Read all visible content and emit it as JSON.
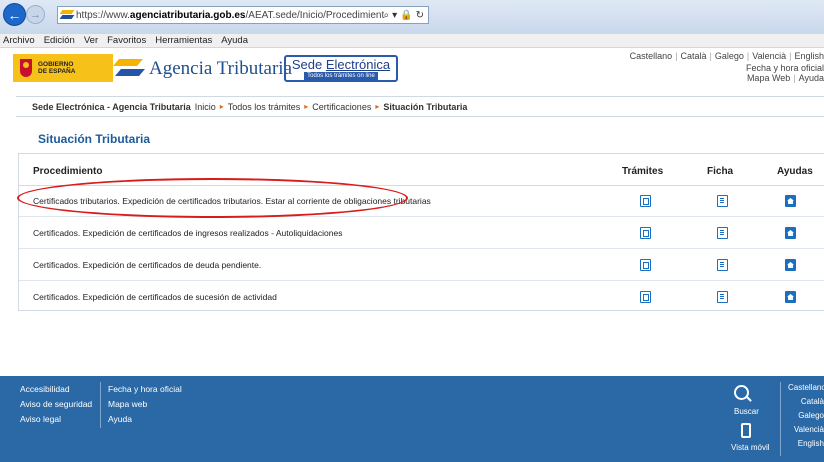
{
  "browser": {
    "url_prefix": "https://www.",
    "url_domain": "agenciatributaria.gob.es",
    "url_path": "/AEAT.sede/Inicio/Procedimientos_y_Servicios/Cert",
    "search_icon": "search-icon",
    "menu": [
      "Archivo",
      "Edición",
      "Ver",
      "Favoritos",
      "Herramientas",
      "Ayuda"
    ]
  },
  "header": {
    "gov_text": "GOBIERNO DE ESPAÑA",
    "agency_name": "Agencia Tributaria",
    "sede_title_plain": "Sede ",
    "sede_title_underlined": "Electrónica",
    "sede_sub": "Todos los trámites on line",
    "languages": [
      "Castellano",
      "Català",
      "Galego",
      "Valencià",
      "English"
    ],
    "util1": "Fecha y hora oficial",
    "util2a": "Mapa Web",
    "util2b": "Ayuda"
  },
  "breadcrumb": {
    "first": "Sede Electrónica - Agencia Tributaria",
    "items": [
      "Inicio",
      "Todos los trámites",
      "Certificaciones"
    ],
    "current": "Situación Tributaria"
  },
  "main": {
    "title": "Situación Tributaria",
    "columns": [
      "Procedimiento",
      "Trámites",
      "Ficha",
      "Ayudas"
    ],
    "rows": [
      "Certificados tributarios. Expedición de certificados tributarios. Estar al corriente de obligaciones tributarias",
      "Certificados. Expedición de certificados de ingresos realizados - Autoliquidaciones",
      "Certificados. Expedición de certificados de deuda pendiente.",
      "Certificados. Expedición de certificados de sucesión de actividad"
    ]
  },
  "footer": {
    "col1": [
      "Accesibilidad",
      "Aviso de seguridad",
      "Aviso legal"
    ],
    "col2": [
      "Fecha y hora oficial",
      "Mapa web",
      "Ayuda"
    ],
    "buscar": "Buscar",
    "vista": "Vista móvil",
    "languages": [
      "Castellano",
      "Català",
      "Galego",
      "Valencià",
      "English"
    ]
  },
  "colors": {
    "accent": "#1d5b9a",
    "footer_bg": "#2a69a5",
    "highlight": "#d81b1b",
    "breadcrumb_sep": "#e06b1a"
  }
}
